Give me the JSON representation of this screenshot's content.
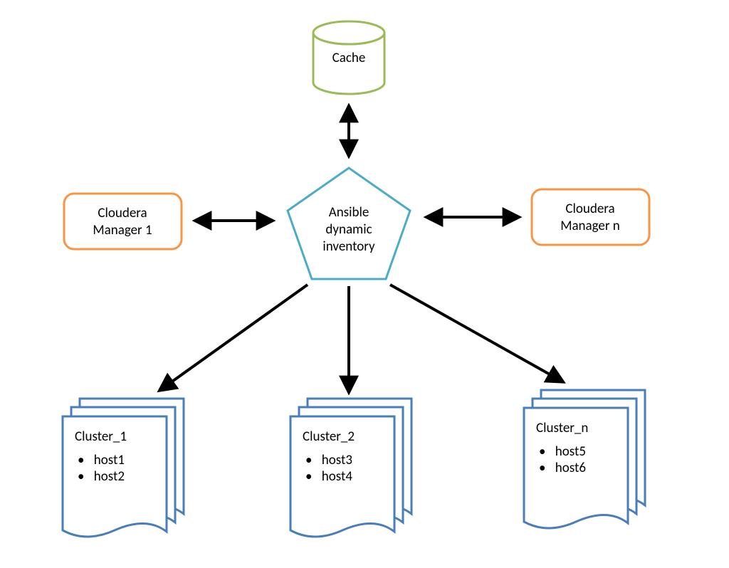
{
  "cache": {
    "label": "Cache"
  },
  "center": {
    "line1": "Ansible",
    "line2": "dynamic",
    "line3": "inventory"
  },
  "cm1": {
    "line1": "Cloudera",
    "line2": "Manager 1"
  },
  "cmN": {
    "line1": "Cloudera",
    "line2": "Manager n"
  },
  "clusters": {
    "c1": {
      "title": "Cluster_1",
      "hosts": [
        "host1",
        "host2"
      ]
    },
    "c2": {
      "title": "Cluster_2",
      "hosts": [
        "host3",
        "host4"
      ]
    },
    "cn": {
      "title": "Cluster_n",
      "hosts": [
        "host5",
        "host6"
      ]
    }
  },
  "colors": {
    "cache": "#9bbb59",
    "cm": "#f79646",
    "center": "#4bacc6",
    "clusterStroke": "#4a7ebb",
    "clusterFill": "#ffffff",
    "arrow": "#000000"
  }
}
